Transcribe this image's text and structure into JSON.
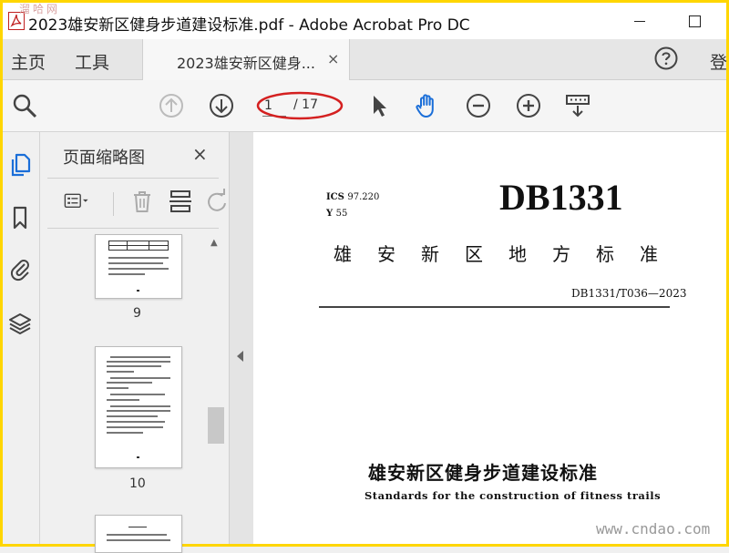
{
  "window": {
    "title": "2023雄安新区健身步道建设标准.pdf - Adobe Acrobat Pro DC",
    "watermark": "溜哈网"
  },
  "menu": {
    "home": "主页",
    "tools": "工具",
    "tab_label": "2023雄安新区健身...",
    "tab_close": "×",
    "signin": "登"
  },
  "toolbar": {
    "current_page": "1",
    "total_pages": "/ 17",
    "icons": [
      "search-icon",
      "page-up-icon",
      "page-down-icon",
      "select-cursor-icon",
      "hand-tool-icon",
      "zoom-out-icon",
      "zoom-in-icon",
      "read-mode-icon"
    ],
    "annotation_color": "#d42020"
  },
  "sidebar": {
    "title": "页面缩略图",
    "close": "×",
    "thumbnails": [
      {
        "page": "9"
      },
      {
        "page": "10"
      },
      {
        "page": ""
      }
    ]
  },
  "document": {
    "ics": "ICS",
    "ics_value": "97.220",
    "y": "Y",
    "y_value": "55",
    "code": "DB1331",
    "local_standard": "雄安新区地方标准",
    "standard_number": "DB1331/T036—2023",
    "title_cn": "雄安新区健身步道建设标准",
    "title_en": "Standards for the construction of fitness trails",
    "site_mark": "www.cndao.com"
  },
  "colors": {
    "frame": "#ffd600",
    "hand_tool": "#1a6ed8",
    "sidebar_icon_active": "#1a6ed8"
  }
}
